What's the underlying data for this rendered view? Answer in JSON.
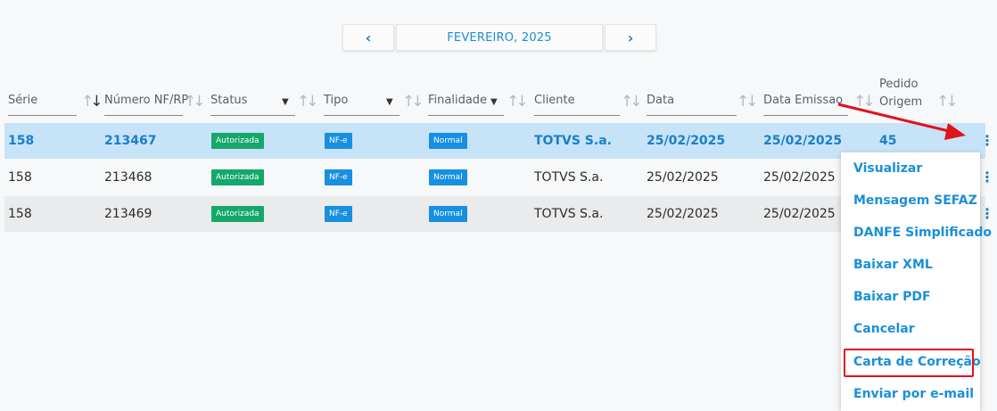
{
  "nav": {
    "prev_icon": "‹",
    "next_icon": "›",
    "month_label": "FEVEREIRO, 2025"
  },
  "columns": [
    {
      "label": "Série"
    },
    {
      "label": "Número NF/RP"
    },
    {
      "label": "Status"
    },
    {
      "label": "Tipo"
    },
    {
      "label": "Finalidade"
    },
    {
      "label": "Cliente"
    },
    {
      "label": "Data"
    },
    {
      "label": "Data Emissao"
    },
    {
      "label": "Pedido Origem"
    }
  ],
  "rows": [
    {
      "serie": "158",
      "numero": "213467",
      "status": "Autorizada",
      "tipo": "NF-e",
      "finalidade": "Normal",
      "cliente": "TOTVS S.a.",
      "data": "25/02/2025",
      "emissao": "25/02/2025",
      "pedido": "45"
    },
    {
      "serie": "158",
      "numero": "213468",
      "status": "Autorizada",
      "tipo": "NF-e",
      "finalidade": "Normal",
      "cliente": "TOTVS S.a.",
      "data": "25/02/2025",
      "emissao": "25/02/2025",
      "pedido": ""
    },
    {
      "serie": "158",
      "numero": "213469",
      "status": "Autorizada",
      "tipo": "NF-e",
      "finalidade": "Normal",
      "cliente": "TOTVS S.a.",
      "data": "25/02/2025",
      "emissao": "25/02/2025",
      "pedido": ""
    }
  ],
  "menu": {
    "items": [
      "Visualizar",
      "Mensagem SEFAZ",
      "DANFE Simplificado",
      "Baixar XML",
      "Baixar PDF",
      "Cancelar",
      "Carta de Correção",
      "Enviar por e-mail"
    ]
  },
  "icons": {
    "more": "⋮",
    "sort": "↑↓",
    "caret": "▼"
  },
  "colors": {
    "accent": "#1a8fd8",
    "selected_row": "#c7e3f7",
    "status_green": "#14a86a",
    "badge_blue": "#1690e0",
    "annotation_red": "#e0121a"
  }
}
